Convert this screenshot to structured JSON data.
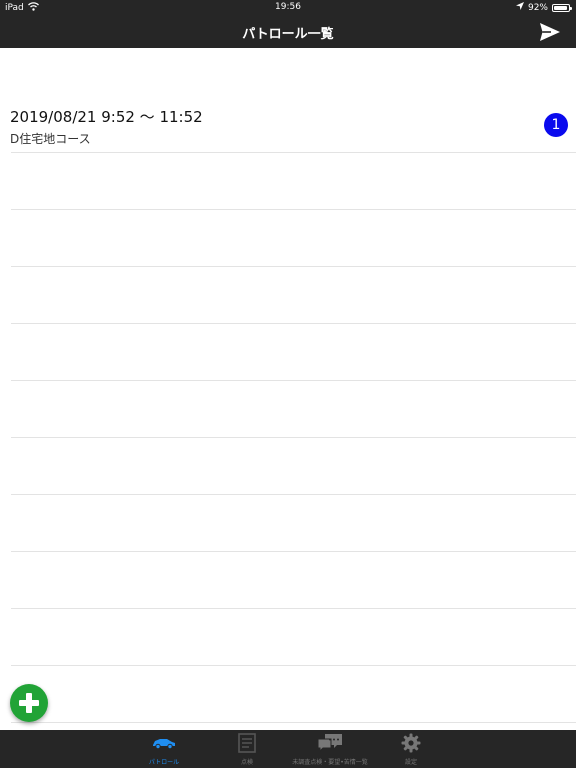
{
  "status_bar": {
    "device": "iPad",
    "time": "19:56",
    "battery_percent": "92%",
    "battery_level": 0.92
  },
  "nav": {
    "title": "パトロール一覧",
    "send_icon": "paper-plane-icon"
  },
  "patrols": [
    {
      "time_range": "2019/08/21 9:52 〜 11:52",
      "course": "D住宅地コース",
      "badge": "1",
      "badge_color": "#0a0aee"
    }
  ],
  "fab": {
    "icon": "plus-icon",
    "color": "#21a336"
  },
  "tabs": [
    {
      "label": "パトロール",
      "icon": "car-icon",
      "active": true
    },
    {
      "label": "点検",
      "icon": "checklist-icon",
      "active": false
    },
    {
      "label": "未調査点検・要望•苦情一覧",
      "icon": "chat-bubbles-icon",
      "active": false
    },
    {
      "label": "設定",
      "icon": "gear-icon",
      "active": false
    }
  ],
  "colors": {
    "bar_background": "#262626",
    "active_tab": "#1f8ef1",
    "inactive_tab": "#777777"
  }
}
